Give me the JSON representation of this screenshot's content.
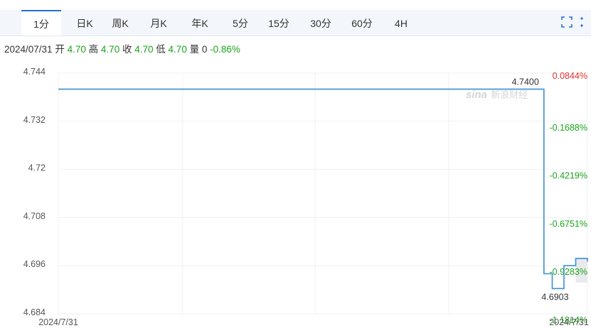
{
  "tabs": [
    {
      "label": "1分",
      "active": true
    },
    {
      "label": "日K",
      "active": false
    },
    {
      "label": "周K",
      "active": false
    },
    {
      "label": "月K",
      "active": false
    },
    {
      "label": "年K",
      "active": false
    },
    {
      "label": "5分",
      "active": false
    },
    {
      "label": "15分",
      "active": false
    },
    {
      "label": "30分",
      "active": false
    },
    {
      "label": "60分",
      "active": false
    },
    {
      "label": "4H",
      "active": false
    }
  ],
  "info": {
    "date": "2024/07/31",
    "open_label": "开",
    "open": "4.70",
    "high_label": "高",
    "high": "4.70",
    "close_label": "收",
    "close": "4.70",
    "low_label": "低",
    "low": "4.70",
    "volume_label": "量",
    "volume": "0",
    "change": "-0.86%"
  },
  "watermark": {
    "brand": "sina",
    "name": "新浪财经"
  },
  "colors": {
    "line": "#3a8fd0",
    "up": "#e0302c",
    "down": "#1aa31a",
    "accent": "#1f6fd1"
  },
  "icons": [
    "fullscreen-icon",
    "more-vertical-icon"
  ],
  "chart_data": {
    "type": "line",
    "ylim": [
      4.684,
      4.744
    ],
    "y_ticks": [
      "4.744",
      "4.732",
      "4.72",
      "4.708",
      "4.696",
      "4.684"
    ],
    "right_ticks": [
      "0.0844%",
      "-0.1688%",
      "-0.4219%",
      "-0.6751%",
      "-0.9283%",
      "-1.1814%"
    ],
    "x_ticks": [
      "2024/7/31",
      "",
      "",
      "",
      "2024/7/31"
    ],
    "series": [
      {
        "values": [
          4.74,
          4.74,
          4.74,
          4.74,
          4.74,
          4.74,
          4.74,
          4.74,
          4.74,
          4.74,
          4.74,
          4.74,
          4.74,
          4.74,
          4.74,
          4.74,
          4.74,
          4.74,
          4.74,
          4.74,
          4.74,
          4.74,
          4.74,
          4.74,
          4.74,
          4.74,
          4.74,
          4.74,
          4.74,
          4.74,
          4.74,
          4.74,
          4.74,
          4.74,
          4.74,
          4.74,
          4.74,
          4.74,
          4.74,
          4.74,
          4.74,
          4.74,
          4.74,
          4.74,
          4.74,
          4.74,
          4.74,
          4.74,
          4.74,
          4.74,
          4.74,
          4.74,
          4.74,
          4.74,
          4.74,
          4.74,
          4.74,
          4.74,
          4.74,
          4.74,
          4.74,
          4.74,
          4.74,
          4.74,
          4.74,
          4.74,
          4.74,
          4.74,
          4.74,
          4.74,
          4.74,
          4.74,
          4.74,
          4.74,
          4.74,
          4.74,
          4.74,
          4.74,
          4.74,
          4.74,
          4.74,
          4.74,
          4.74,
          4.74,
          4.74,
          4.74,
          4.74,
          4.74,
          4.74,
          4.74,
          4.74,
          4.74,
          4.74,
          4.74,
          4.74,
          4.74,
          4.74,
          4.74,
          4.74,
          4.74,
          4.74,
          4.74,
          4.74,
          4.74,
          4.74,
          4.74,
          4.74,
          4.74,
          4.74,
          4.74,
          4.74,
          4.74,
          4.74,
          4.74,
          4.74,
          4.74,
          4.74,
          4.74,
          4.74,
          4.74,
          4.74,
          4.74,
          4.74,
          4.74,
          4.74,
          4.74,
          4.74,
          4.74,
          4.74,
          4.74,
          4.74,
          4.74,
          4.74,
          4.74,
          4.74,
          4.74,
          4.74,
          4.74,
          4.74,
          4.74,
          4.74,
          4.74,
          4.74,
          4.74,
          4.74,
          4.74,
          4.74,
          4.74,
          4.74,
          4.74,
          4.74,
          4.74,
          4.74,
          4.74,
          4.74,
          4.74,
          4.74,
          4.74,
          4.74,
          4.74,
          4.74,
          4.74,
          4.74,
          4.74,
          4.74,
          4.74,
          4.74,
          4.74,
          4.74,
          4.74,
          4.74,
          4.74,
          4.74,
          4.74,
          4.74,
          4.74,
          4.74,
          4.74,
          4.74,
          4.74,
          4.74,
          4.74,
          4.74,
          4.74,
          4.74,
          4.74,
          4.74,
          4.74,
          4.74,
          4.74,
          4.74,
          4.74,
          4.74,
          4.74,
          4.74,
          4.74,
          4.74,
          4.74,
          4.74,
          4.74,
          4.74,
          4.74,
          4.74,
          4.74,
          4.74,
          4.74,
          4.74,
          4.74,
          4.74,
          4.74,
          4.74,
          4.74,
          4.74,
          4.74,
          4.74,
          4.74,
          4.74,
          4.74,
          4.74,
          4.74,
          4.74,
          4.74,
          4.74,
          4.74,
          4.74,
          4.74,
          4.74,
          4.74,
          4.74,
          4.74,
          4.74,
          4.74,
          4.74,
          4.74,
          4.74,
          4.74,
          4.74,
          4.74,
          4.74,
          4.74,
          4.74,
          4.74,
          4.74,
          4.74,
          4.74,
          4.74,
          4.74,
          4.74,
          4.74,
          4.74,
          4.74,
          4.74,
          4.74,
          4.74,
          4.74,
          4.74,
          4.74,
          4.74,
          4.74,
          4.74,
          4.74,
          4.74,
          4.74,
          4.74,
          4.74,
          4.74,
          4.74,
          4.74,
          4.74,
          4.74,
          4.74,
          4.74,
          4.74,
          4.74,
          4.74,
          4.74,
          4.74,
          4.74,
          4.74,
          4.74,
          4.74,
          4.74,
          4.74,
          4.74,
          4.74,
          4.74,
          4.74,
          4.74,
          4.74,
          4.74,
          4.74,
          4.74,
          4.74,
          4.74,
          4.74,
          4.74,
          4.74,
          4.74,
          4.74,
          4.74,
          4.74,
          4.74,
          4.74,
          4.74,
          4.74,
          4.74,
          4.74,
          4.74,
          4.74,
          4.74,
          4.74,
          4.74,
          4.74,
          4.74,
          4.74,
          4.74,
          4.74,
          4.74,
          4.74,
          4.74,
          4.74,
          4.74,
          4.74,
          4.74,
          4.74,
          4.74,
          4.74,
          4.74,
          4.74,
          4.74,
          4.74,
          4.74,
          4.74,
          4.74,
          4.74,
          4.74,
          4.74,
          4.74,
          4.74,
          4.74,
          4.74,
          4.74,
          4.74,
          4.74,
          4.74,
          4.74,
          4.74,
          4.74,
          4.74,
          4.74,
          4.74,
          4.74,
          4.74,
          4.74,
          4.74,
          4.74,
          4.74,
          4.74,
          4.74,
          4.74,
          4.74,
          4.74,
          4.74,
          4.74,
          4.74,
          4.74,
          4.74,
          4.74,
          4.74,
          4.74,
          4.74,
          4.74,
          4.74,
          4.74,
          4.74,
          4.74,
          4.74,
          4.74,
          4.74,
          4.74,
          4.74,
          4.74,
          4.74,
          4.74,
          4.74,
          4.74,
          4.74,
          4.74,
          4.74,
          4.74,
          4.74,
          4.74,
          4.74,
          4.74,
          4.74,
          4.74,
          4.74,
          4.74,
          4.74,
          4.74,
          4.74,
          4.74,
          4.74,
          4.74,
          4.74,
          4.74,
          4.74,
          4.74,
          4.74,
          4.74,
          4.74,
          4.74,
          4.74,
          4.74,
          4.74,
          4.74,
          4.74,
          4.74,
          4.74,
          4.74,
          4.74,
          4.74,
          4.74,
          4.74,
          4.74,
          4.74,
          4.74,
          4.74,
          4.74,
          4.74,
          4.74,
          4.74,
          4.74,
          4.74,
          4.74,
          4.74,
          4.74,
          4.74,
          4.74,
          4.74,
          4.74,
          4.74,
          4.74,
          4.74,
          4.74,
          4.74,
          4.74,
          4.74,
          4.74,
          4.74,
          4.74,
          4.74,
          4.74,
          4.74,
          4.74,
          4.74,
          4.74,
          4.74,
          4.74,
          4.74,
          4.74,
          4.74,
          4.74,
          4.74,
          4.74,
          4.74,
          4.74,
          4.74,
          4.74,
          4.74,
          4.74,
          4.74,
          4.74,
          4.74,
          4.74,
          4.74,
          4.74,
          4.74,
          4.74,
          4.74,
          4.74,
          4.74,
          4.74,
          4.74,
          4.74,
          4.74,
          4.74,
          4.74,
          4.74,
          4.74,
          4.74,
          4.74,
          4.74,
          4.74,
          4.74,
          4.74,
          4.74,
          4.74,
          4.74,
          4.74,
          4.74,
          4.74,
          4.74,
          4.74,
          4.74,
          4.74,
          4.74,
          4.74,
          4.74,
          4.74,
          4.74,
          4.74,
          4.74,
          4.74,
          4.74,
          4.74,
          4.74,
          4.74,
          4.74,
          4.74,
          4.74,
          4.74,
          4.74,
          4.74,
          4.74,
          4.74,
          4.74,
          4.74,
          4.74,
          4.74,
          4.74,
          4.74,
          4.74,
          4.74,
          4.74,
          4.74,
          4.74,
          4.74,
          4.74,
          4.74,
          4.74,
          4.74,
          4.74,
          4.74,
          4.74,
          4.74,
          4.74,
          4.74,
          4.74,
          4.74,
          4.74,
          4.74,
          4.74,
          4.74,
          4.74,
          4.74,
          4.74,
          4.74,
          4.74,
          4.74,
          4.74,
          4.74,
          4.74,
          4.74,
          4.74,
          4.74,
          4.74,
          4.74,
          4.74,
          4.74,
          4.74,
          4.74,
          4.74,
          4.74,
          4.74,
          4.74,
          4.74,
          4.74,
          4.74,
          4.74,
          4.74,
          4.74,
          4.74,
          4.74,
          4.74,
          4.74,
          4.74,
          4.74,
          4.74,
          4.74,
          4.74,
          4.74,
          4.74,
          4.74,
          4.74,
          4.74,
          4.74,
          4.74,
          4.74,
          4.74,
          4.74,
          4.74,
          4.74,
          4.74,
          4.74,
          4.74,
          4.74,
          4.74,
          4.74,
          4.74,
          4.74,
          4.74,
          4.74,
          4.74,
          4.74,
          4.74,
          4.74,
          4.74,
          4.74,
          4.74,
          4.74,
          4.74,
          4.74,
          4.74,
          4.74,
          4.74,
          4.74,
          4.74,
          4.74,
          4.74,
          4.74,
          4.74,
          4.74,
          4.74,
          4.74,
          4.74,
          4.74,
          4.74,
          4.74,
          4.74,
          4.74,
          4.74,
          4.74,
          4.74,
          4.74,
          4.74,
          4.74,
          4.74,
          4.74,
          4.74,
          4.74,
          4.74,
          4.74,
          4.74,
          4.74,
          4.74,
          4.74,
          4.74,
          4.74,
          4.74,
          4.74,
          4.74,
          4.74,
          4.74,
          4.74,
          4.74,
          4.74,
          4.74,
          4.74,
          4.74,
          4.74,
          4.74,
          4.74,
          4.74,
          4.74,
          4.74,
          4.74,
          4.74,
          4.74,
          4.74,
          4.74,
          4.74,
          4.74,
          4.74,
          4.74,
          4.74,
          4.74,
          4.74,
          4.74,
          4.74,
          4.74,
          4.74,
          4.74,
          4.74,
          4.74,
          4.74,
          4.74,
          4.74,
          4.74,
          4.74,
          4.74,
          4.74,
          4.74,
          4.694,
          4.694,
          4.694,
          4.694,
          4.694,
          4.694,
          4.694,
          4.694,
          4.694,
          4.694,
          4.694,
          4.694,
          4.6903,
          4.6903,
          4.6903,
          4.6903,
          4.6903,
          4.6903,
          4.6903,
          4.6903,
          4.6903,
          4.6903,
          4.6903,
          4.6903,
          4.6903,
          4.6903,
          4.6903,
          4.6903,
          4.6903,
          4.696,
          4.696,
          4.696,
          4.696,
          4.696,
          4.696,
          4.696,
          4.696,
          4.696,
          4.696,
          4.696,
          4.696,
          4.696,
          4.696,
          4.696,
          4.696,
          4.696,
          4.6978,
          4.6978,
          4.6978,
          4.6978,
          4.6978,
          4.6978,
          4.6978,
          4.6978,
          4.6978,
          4.6978,
          4.6978,
          4.6978,
          4.6978,
          4.6978,
          4.6978,
          4.6978,
          4.6978,
          4.697
        ]
      }
    ],
    "annotations": {
      "max": "4.7400",
      "min": "4.6903"
    }
  }
}
